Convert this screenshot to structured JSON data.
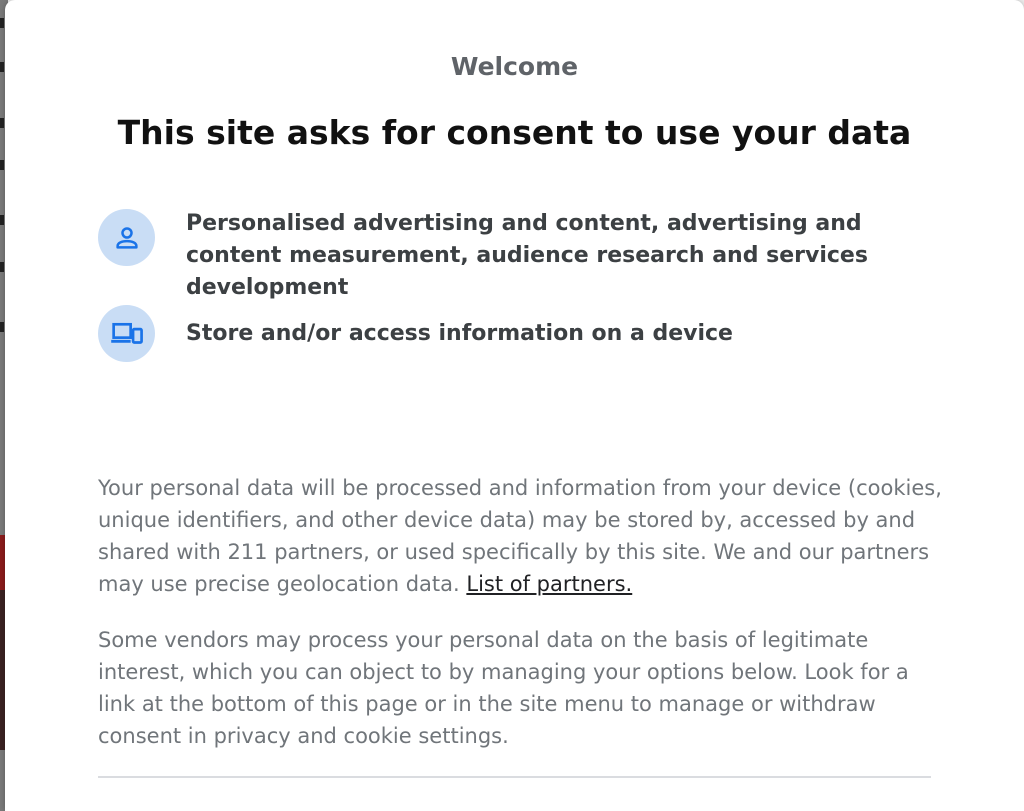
{
  "dialog": {
    "welcome": "Welcome",
    "headline": "This site asks for consent to use your data",
    "purposes": [
      {
        "icon": "person-icon",
        "label": "Personalised advertising and content, advertising and content measurement, audience research and services development"
      },
      {
        "icon": "devices-icon",
        "label": "Store and/or access information on a device"
      }
    ],
    "paragraph1": "Your personal data will be processed and information from your device (cookies, unique identifiers, and other device data) may be stored by, accessed by and shared with 211 partners, or used specifically by this site. We and our partners may use precise geolocation data.",
    "partners_link": "List of partners.",
    "paragraph2": "Some vendors may process your personal data on the basis of legitimate interest, which you can object to by managing your options below. Look for a link at the bottom of this page or in the site menu to manage or withdraw consent in privacy and cookie settings."
  },
  "colors": {
    "icon_bg": "#c9ddf5",
    "icon_fg": "#1a73e8",
    "heading": "#111111",
    "body": "#70757a"
  }
}
